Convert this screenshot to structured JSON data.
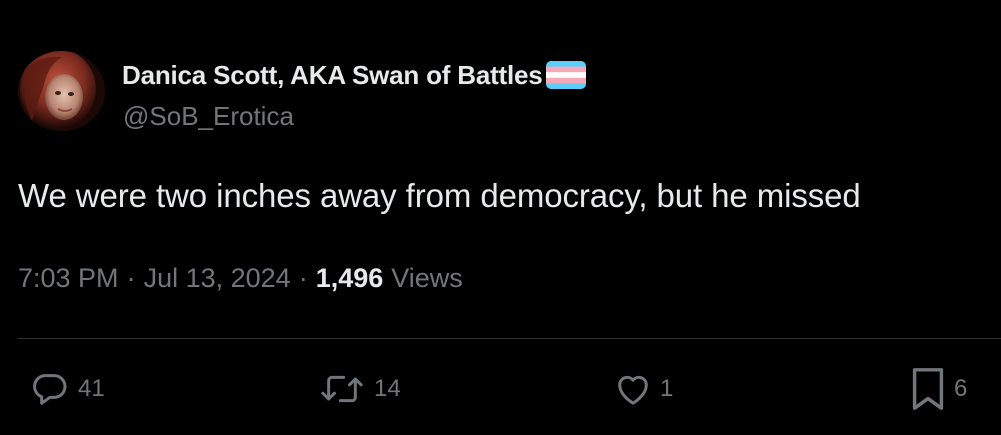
{
  "author": {
    "display_name": "Danica Scott, AKA Swan of Battles",
    "handle": "@SoB_Erotica",
    "flag_icon": "transgender-flag-icon",
    "flag_colors": [
      "#5BCEFA",
      "#F5A9B8",
      "#FFFFFF",
      "#F5A9B8",
      "#5BCEFA"
    ]
  },
  "tweet": {
    "text": "We were two inches away from democracy, but he missed"
  },
  "meta": {
    "time": "7:03 PM",
    "separator": "·",
    "date": "Jul 13, 2024",
    "views_count": "1,496",
    "views_label": "Views"
  },
  "actions": {
    "reply": {
      "icon": "reply-icon",
      "count": "41"
    },
    "retweet": {
      "icon": "retweet-icon",
      "count": "14"
    },
    "like": {
      "icon": "heart-icon",
      "count": "1"
    },
    "bookmark": {
      "icon": "bookmark-icon",
      "count": "6"
    }
  },
  "colors": {
    "background": "#000000",
    "primary_text": "#e7e9ea",
    "secondary_text": "#71767b",
    "divider": "#2f3336"
  }
}
